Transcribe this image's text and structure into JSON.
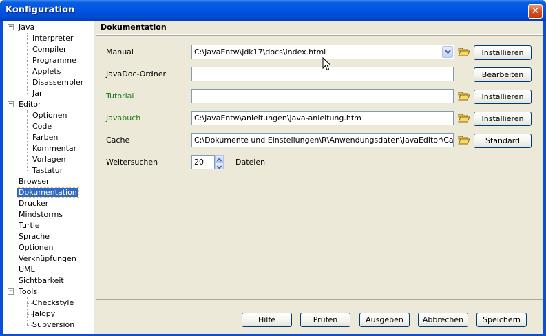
{
  "window": {
    "title": "Konfiguration",
    "close_symbol": "✕"
  },
  "tree": {
    "items": [
      {
        "label": "Java",
        "level": 0,
        "expander": "−"
      },
      {
        "label": "Interpreter",
        "level": 1
      },
      {
        "label": "Compiler",
        "level": 1
      },
      {
        "label": "Programme",
        "level": 1
      },
      {
        "label": "Applets",
        "level": 1
      },
      {
        "label": "Disassembler",
        "level": 1
      },
      {
        "label": "Jar",
        "level": 1
      },
      {
        "label": "Editor",
        "level": 0,
        "expander": "−"
      },
      {
        "label": "Optionen",
        "level": 1
      },
      {
        "label": "Code",
        "level": 1
      },
      {
        "label": "Farben",
        "level": 1
      },
      {
        "label": "Kommentar",
        "level": 1
      },
      {
        "label": "Vorlagen",
        "level": 1
      },
      {
        "label": "Tastatur",
        "level": 1
      },
      {
        "label": "Browser",
        "level": 0
      },
      {
        "label": "Dokumentation",
        "level": 0,
        "selected": true
      },
      {
        "label": "Drucker",
        "level": 0
      },
      {
        "label": "Mindstorms",
        "level": 0
      },
      {
        "label": "Turtle",
        "level": 0
      },
      {
        "label": "Sprache",
        "level": 0
      },
      {
        "label": "Optionen",
        "level": 0
      },
      {
        "label": "Verknüpfungen",
        "level": 0
      },
      {
        "label": "UML",
        "level": 0
      },
      {
        "label": "Sichtbarkeit",
        "level": 0
      },
      {
        "label": "Tools",
        "level": 0,
        "expander": "−"
      },
      {
        "label": "Checkstyle",
        "level": 1
      },
      {
        "label": "Jalopy",
        "level": 1
      },
      {
        "label": "Subversion",
        "level": 1
      }
    ]
  },
  "panel": {
    "title": "Dokumentation",
    "manual": {
      "label": "Manual",
      "value": "C:\\JavaEntw\\jdk17\\docs\\index.html",
      "button": "Installieren"
    },
    "javadoc": {
      "label": "JavaDoc-Ordner",
      "value": "",
      "button": "Bearbeiten"
    },
    "tutorial": {
      "label": "Tutorial",
      "value": "",
      "button": "Installieren",
      "color": "#1e7a1e"
    },
    "javabuch": {
      "label": "Javabuch",
      "value": "C:\\JavaEntw\\anleitungen\\java-anleitung.htm",
      "button": "Installieren",
      "color": "#1e7a1e"
    },
    "cache": {
      "label": "Cache",
      "value": "C:\\Dokumente und Einstellungen\\R\\Anwendungsdaten\\JavaEditor\\Cache",
      "button": "Standard"
    },
    "weitersuchen": {
      "label": "Weitersuchen",
      "value": "20",
      "unit": "Dateien"
    }
  },
  "footer": {
    "help": "Hilfe",
    "check": "Prüfen",
    "output": "Ausgeben",
    "cancel": "Abbrechen",
    "save": "Speichern"
  },
  "colors": {
    "titlebar": "#0054e3",
    "selection": "#316ac5",
    "dialog_bg": "#ece9d8"
  }
}
